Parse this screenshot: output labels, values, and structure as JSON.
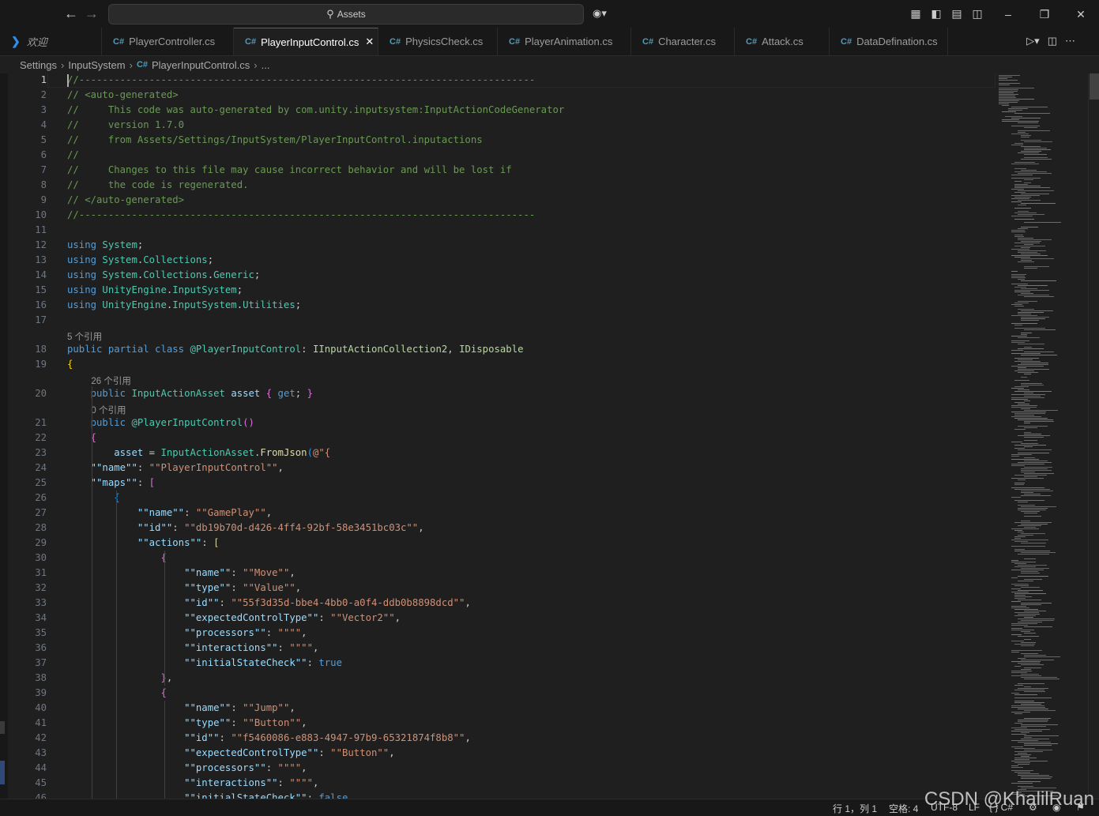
{
  "titlebar": {
    "search_text": "Assets",
    "back_icon": "arrow-left-icon",
    "forward_icon": "arrow-right-icon"
  },
  "tabs": [
    {
      "label": "欢迎",
      "type": "welcome"
    },
    {
      "label": "PlayerController.cs",
      "type": "cs"
    },
    {
      "label": "PlayerInputControl.cs",
      "type": "cs",
      "active": true
    },
    {
      "label": "PhysicsCheck.cs",
      "type": "cs"
    },
    {
      "label": "PlayerAnimation.cs",
      "type": "cs"
    },
    {
      "label": "Character.cs",
      "type": "cs"
    },
    {
      "label": "Attack.cs",
      "type": "cs"
    },
    {
      "label": "DataDefination.cs",
      "type": "cs"
    }
  ],
  "tab_icon_text": "C#",
  "breadcrumb": {
    "items": [
      "Settings",
      "InputSystem",
      "PlayerInputControl.cs",
      "..."
    ]
  },
  "editor": {
    "lines": [
      {
        "n": 1,
        "t": [
          [
            "c-com",
            "//------------------------------------------------------------------------------"
          ]
        ]
      },
      {
        "n": 2,
        "t": [
          [
            "c-com",
            "// <auto-generated>"
          ]
        ]
      },
      {
        "n": 3,
        "t": [
          [
            "c-com",
            "//     This code was auto-generated by com.unity.inputsystem:InputActionCodeGenerator"
          ]
        ]
      },
      {
        "n": 4,
        "t": [
          [
            "c-com",
            "//     version 1.7.0"
          ]
        ]
      },
      {
        "n": 5,
        "t": [
          [
            "c-com",
            "//     from Assets/Settings/InputSystem/PlayerInputControl.inputactions"
          ]
        ]
      },
      {
        "n": 6,
        "t": [
          [
            "c-com",
            "//"
          ]
        ]
      },
      {
        "n": 7,
        "t": [
          [
            "c-com",
            "//     Changes to this file may cause incorrect behavior and will be lost if"
          ]
        ]
      },
      {
        "n": 8,
        "t": [
          [
            "c-com",
            "//     the code is regenerated."
          ]
        ]
      },
      {
        "n": 9,
        "t": [
          [
            "c-com",
            "// </auto-generated>"
          ]
        ]
      },
      {
        "n": 10,
        "t": [
          [
            "c-com",
            "//------------------------------------------------------------------------------"
          ]
        ]
      },
      {
        "n": 11,
        "t": []
      },
      {
        "n": 12,
        "t": [
          [
            "c-kw",
            "using "
          ],
          [
            "c-ns",
            "System"
          ],
          [
            "c-pun",
            ";"
          ]
        ]
      },
      {
        "n": 13,
        "t": [
          [
            "c-kw",
            "using "
          ],
          [
            "c-ns",
            "System"
          ],
          [
            "c-pun",
            "."
          ],
          [
            "c-ns",
            "Collections"
          ],
          [
            "c-pun",
            ";"
          ]
        ]
      },
      {
        "n": 14,
        "t": [
          [
            "c-kw",
            "using "
          ],
          [
            "c-ns",
            "System"
          ],
          [
            "c-pun",
            "."
          ],
          [
            "c-ns",
            "Collections"
          ],
          [
            "c-pun",
            "."
          ],
          [
            "c-ns",
            "Generic"
          ],
          [
            "c-pun",
            ";"
          ]
        ]
      },
      {
        "n": 15,
        "t": [
          [
            "c-kw",
            "using "
          ],
          [
            "c-ns",
            "UnityEngine"
          ],
          [
            "c-pun",
            "."
          ],
          [
            "c-ns",
            "InputSystem"
          ],
          [
            "c-pun",
            ";"
          ]
        ]
      },
      {
        "n": 16,
        "t": [
          [
            "c-kw",
            "using "
          ],
          [
            "c-ns",
            "UnityEngine"
          ],
          [
            "c-pun",
            "."
          ],
          [
            "c-ns",
            "InputSystem"
          ],
          [
            "c-pun",
            "."
          ],
          [
            "c-ns",
            "Utilities"
          ],
          [
            "c-pun",
            ";"
          ]
        ]
      },
      {
        "n": 17,
        "t": []
      },
      {
        "n": 18,
        "lens": "5 个引用",
        "t": [
          [
            "c-kw",
            "public partial class "
          ],
          [
            "c-ns",
            "@PlayerInputControl"
          ],
          [
            "c-pun",
            ": "
          ],
          [
            "c-itf",
            "IInputActionCollection2"
          ],
          [
            "c-pun",
            ", "
          ],
          [
            "c-itf",
            "IDisposable"
          ]
        ]
      },
      {
        "n": 19,
        "t": [
          [
            "c-br1",
            "{"
          ]
        ]
      },
      {
        "n": 20,
        "lens": "26 个引用",
        "t": [
          [
            "c-pun",
            "    "
          ],
          [
            "c-kw",
            "public "
          ],
          [
            "c-ns",
            "InputActionAsset "
          ],
          [
            "c-id",
            "asset "
          ],
          [
            "c-br2",
            "{ "
          ],
          [
            "c-kw",
            "get"
          ],
          [
            "c-pun",
            "; "
          ],
          [
            "c-br2",
            "}"
          ]
        ]
      },
      {
        "n": 21,
        "lens": "0 个引用",
        "t": [
          [
            "c-pun",
            "    "
          ],
          [
            "c-kw",
            "public "
          ],
          [
            "c-ns",
            "@PlayerInputControl"
          ],
          [
            "c-br2",
            "()"
          ]
        ]
      },
      {
        "n": 22,
        "t": [
          [
            "c-br2",
            "    {"
          ]
        ]
      },
      {
        "n": 23,
        "t": [
          [
            "c-pun",
            "        "
          ],
          [
            "c-id",
            "asset "
          ],
          [
            "c-pun",
            "= "
          ],
          [
            "c-ns",
            "InputActionAsset"
          ],
          [
            "c-pun",
            "."
          ],
          [
            "c-fn",
            "FromJson"
          ],
          [
            "c-br3",
            "("
          ],
          [
            "c-str",
            "@\"{"
          ]
        ]
      },
      {
        "n": 24,
        "t": [
          [
            "c-pun",
            "    "
          ],
          [
            "c-id",
            "\"\"name\"\""
          ],
          [
            "c-pun",
            ": "
          ],
          [
            "c-str",
            "\"\"PlayerInputControl\"\""
          ],
          [
            "c-pun",
            ","
          ]
        ]
      },
      {
        "n": 25,
        "t": [
          [
            "c-pun",
            "    "
          ],
          [
            "c-id",
            "\"\"maps\"\""
          ],
          [
            "c-pun",
            ": "
          ],
          [
            "c-br2",
            "["
          ]
        ]
      },
      {
        "n": 26,
        "t": [
          [
            "c-br3",
            "        {"
          ]
        ]
      },
      {
        "n": 27,
        "t": [
          [
            "c-pun",
            "            "
          ],
          [
            "c-id",
            "\"\"name\"\""
          ],
          [
            "c-pun",
            ": "
          ],
          [
            "c-str",
            "\"\"GamePlay\"\""
          ],
          [
            "c-pun",
            ","
          ]
        ]
      },
      {
        "n": 28,
        "t": [
          [
            "c-pun",
            "            "
          ],
          [
            "c-id",
            "\"\"id\"\""
          ],
          [
            "c-pun",
            ": "
          ],
          [
            "c-str",
            "\"\"db19b70d-d426-4ff4-92bf-58e3451bc03c\"\""
          ],
          [
            "c-pun",
            ","
          ]
        ]
      },
      {
        "n": 29,
        "t": [
          [
            "c-pun",
            "            "
          ],
          [
            "c-id",
            "\"\"actions\"\""
          ],
          [
            "c-pun",
            ": "
          ],
          [
            "c-br1",
            "["
          ]
        ]
      },
      {
        "n": 30,
        "t": [
          [
            "c-br2",
            "                {"
          ]
        ]
      },
      {
        "n": 31,
        "t": [
          [
            "c-pun",
            "                    "
          ],
          [
            "c-id",
            "\"\"name\"\""
          ],
          [
            "c-pun",
            ": "
          ],
          [
            "c-str",
            "\"\"Move\"\""
          ],
          [
            "c-pun",
            ","
          ]
        ]
      },
      {
        "n": 32,
        "t": [
          [
            "c-pun",
            "                    "
          ],
          [
            "c-id",
            "\"\"type\"\""
          ],
          [
            "c-pun",
            ": "
          ],
          [
            "c-str",
            "\"\"Value\"\""
          ],
          [
            "c-pun",
            ","
          ]
        ]
      },
      {
        "n": 33,
        "t": [
          [
            "c-pun",
            "                    "
          ],
          [
            "c-id",
            "\"\"id\"\""
          ],
          [
            "c-pun",
            ": "
          ],
          [
            "c-str",
            "\"\"55f3d35d-bbe4-4bb0-a0f4-ddb0b8898dcd\"\""
          ],
          [
            "c-pun",
            ","
          ]
        ]
      },
      {
        "n": 34,
        "t": [
          [
            "c-pun",
            "                    "
          ],
          [
            "c-id",
            "\"\"expectedControlType\"\""
          ],
          [
            "c-pun",
            ": "
          ],
          [
            "c-str",
            "\"\"Vector2\"\""
          ],
          [
            "c-pun",
            ","
          ]
        ]
      },
      {
        "n": 35,
        "t": [
          [
            "c-pun",
            "                    "
          ],
          [
            "c-id",
            "\"\"processors\"\""
          ],
          [
            "c-pun",
            ": "
          ],
          [
            "c-str",
            "\"\"\"\""
          ],
          [
            "c-pun",
            ","
          ]
        ]
      },
      {
        "n": 36,
        "t": [
          [
            "c-pun",
            "                    "
          ],
          [
            "c-id",
            "\"\"interactions\"\""
          ],
          [
            "c-pun",
            ": "
          ],
          [
            "c-str",
            "\"\"\"\""
          ],
          [
            "c-pun",
            ","
          ]
        ]
      },
      {
        "n": 37,
        "t": [
          [
            "c-pun",
            "                    "
          ],
          [
            "c-id",
            "\"\"initialStateCheck\"\""
          ],
          [
            "c-pun",
            ": "
          ],
          [
            "c-kw",
            "true"
          ]
        ]
      },
      {
        "n": 38,
        "t": [
          [
            "c-br2",
            "                }"
          ],
          [
            "c-pun",
            ","
          ]
        ]
      },
      {
        "n": 39,
        "t": [
          [
            "c-br2",
            "                {"
          ]
        ]
      },
      {
        "n": 40,
        "t": [
          [
            "c-pun",
            "                    "
          ],
          [
            "c-id",
            "\"\"name\"\""
          ],
          [
            "c-pun",
            ": "
          ],
          [
            "c-str",
            "\"\"Jump\"\""
          ],
          [
            "c-pun",
            ","
          ]
        ]
      },
      {
        "n": 41,
        "t": [
          [
            "c-pun",
            "                    "
          ],
          [
            "c-id",
            "\"\"type\"\""
          ],
          [
            "c-pun",
            ": "
          ],
          [
            "c-str",
            "\"\"Button\"\""
          ],
          [
            "c-pun",
            ","
          ]
        ]
      },
      {
        "n": 42,
        "t": [
          [
            "c-pun",
            "                    "
          ],
          [
            "c-id",
            "\"\"id\"\""
          ],
          [
            "c-pun",
            ": "
          ],
          [
            "c-str",
            "\"\"f5460086-e883-4947-97b9-65321874f8b8\"\""
          ],
          [
            "c-pun",
            ","
          ]
        ]
      },
      {
        "n": 43,
        "t": [
          [
            "c-pun",
            "                    "
          ],
          [
            "c-id",
            "\"\"expectedControlType\"\""
          ],
          [
            "c-pun",
            ": "
          ],
          [
            "c-str",
            "\"\"Button\"\""
          ],
          [
            "c-pun",
            ","
          ]
        ]
      },
      {
        "n": 44,
        "t": [
          [
            "c-pun",
            "                    "
          ],
          [
            "c-id",
            "\"\"processors\"\""
          ],
          [
            "c-pun",
            ": "
          ],
          [
            "c-str",
            "\"\"\"\""
          ],
          [
            "c-pun",
            ","
          ]
        ]
      },
      {
        "n": 45,
        "t": [
          [
            "c-pun",
            "                    "
          ],
          [
            "c-id",
            "\"\"interactions\"\""
          ],
          [
            "c-pun",
            ": "
          ],
          [
            "c-str",
            "\"\"\"\""
          ],
          [
            "c-pun",
            ","
          ]
        ]
      },
      {
        "n": 46,
        "t": [
          [
            "c-pun",
            "                    "
          ],
          [
            "c-id",
            "\"\"initialStateCheck\"\""
          ],
          [
            "c-pun",
            ": "
          ],
          [
            "c-kw",
            "false"
          ]
        ]
      }
    ]
  },
  "statusbar": {
    "position": "行 1，列 1",
    "spaces": "空格: 4",
    "encoding": "UTF-8",
    "eol": "LF",
    "language": "{ } C#"
  },
  "watermark": "CSDN @KhalilRuan",
  "colors": {
    "accent": "#0078d4",
    "comment": "#6a9955",
    "keyword": "#569cd6",
    "type": "#4ec9b0",
    "string": "#ce9178",
    "property": "#9cdcfe"
  }
}
